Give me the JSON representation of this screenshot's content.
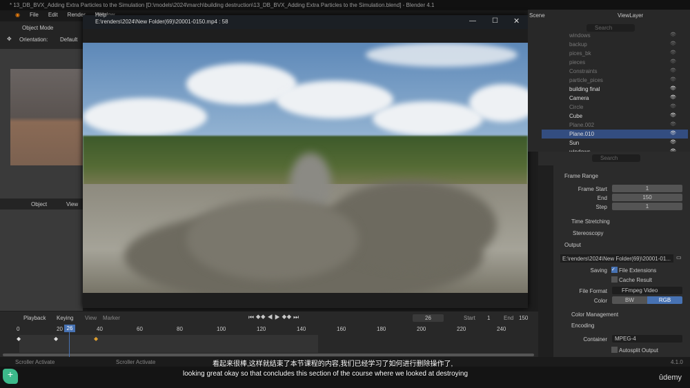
{
  "title_bar": "* 13_DB_BVX_Adding Extra Particles to the Simulation [D:\\models\\2024\\march\\building destruction\\13_DB_BVX_Adding Extra Particles to the Simulation.blend] - Blender 4.1",
  "menu": [
    "File",
    "Edit",
    "Render",
    "Window",
    "Help"
  ],
  "viewport": {
    "mode": "Object Mode",
    "orientation_label": "Orientation:",
    "orientation": "Default",
    "mode2": "Object",
    "view": "View"
  },
  "player": {
    "title": "E:\\renders\\2024\\New Folder(69)\\20001-0150.mp4 :  58"
  },
  "outliner": {
    "scene": "Scene",
    "view_layer": "ViewLayer",
    "search_placeholder": "Search",
    "items": [
      {
        "name": "windows",
        "dim": true
      },
      {
        "name": "backup",
        "dim": true
      },
      {
        "name": "pices_bk",
        "dim": true
      },
      {
        "name": "pieces",
        "dim": true
      },
      {
        "name": "Constraints",
        "dim": true
      },
      {
        "name": "particle_pices",
        "dim": true
      },
      {
        "name": "building final"
      },
      {
        "name": "Camera"
      },
      {
        "name": "Circle",
        "dim": true
      },
      {
        "name": "Cube"
      },
      {
        "name": "Plane.002",
        "dim": true
      },
      {
        "name": "Plane.010",
        "selected": true
      },
      {
        "name": "Sun"
      },
      {
        "name": "windows"
      }
    ]
  },
  "properties": {
    "search_placeholder": "Search",
    "frame_range": "Frame Range",
    "frame_start_label": "Frame Start",
    "frame_start": "1",
    "end_label": "End",
    "end": "150",
    "step_label": "Step",
    "step": "1",
    "time_stretching": "Time Stretching",
    "stereoscopy": "Stereoscopy",
    "output": "Output",
    "output_path": "E:\\renders\\2024\\New Folder(69)\\20001-01...",
    "saving_label": "Saving",
    "file_extensions": "File Extensions",
    "cache_result": "Cache Result",
    "file_format_label": "File Format",
    "file_format": "FFmpeg Video",
    "color_label": "Color",
    "color_bw": "BW",
    "color_rgb": "RGB",
    "color_management": "Color Management",
    "encoding": "Encoding",
    "container_label": "Container",
    "container": "MPEG-4",
    "autosplit": "Autosplit Output"
  },
  "timeline": {
    "playback": "Playback",
    "keying": "Keying",
    "view": "View",
    "marker": "Marker",
    "current_frame": "26",
    "start_label": "Start",
    "start": "1",
    "end_label": "End",
    "end": "150",
    "ticks": [
      "0",
      "20",
      "40",
      "60",
      "80",
      "100",
      "120",
      "140",
      "160",
      "180",
      "200",
      "220",
      "240"
    ]
  },
  "status": {
    "left": "Scroller Activate",
    "mid": "Scroller Activate",
    "version": "4.1.0"
  },
  "subtitles": {
    "zh": "看起来很棒,这样就结束了本节课程的内容,我们已经学习了如何进行删除操作了,",
    "en": "looking great okay so that concludes this section of the course where we looked at destroying"
  },
  "brand": "ûdemy",
  "colors": {
    "accent": "#4772b3",
    "selected_row": "#334d80",
    "keyframe": "#e0a030"
  }
}
